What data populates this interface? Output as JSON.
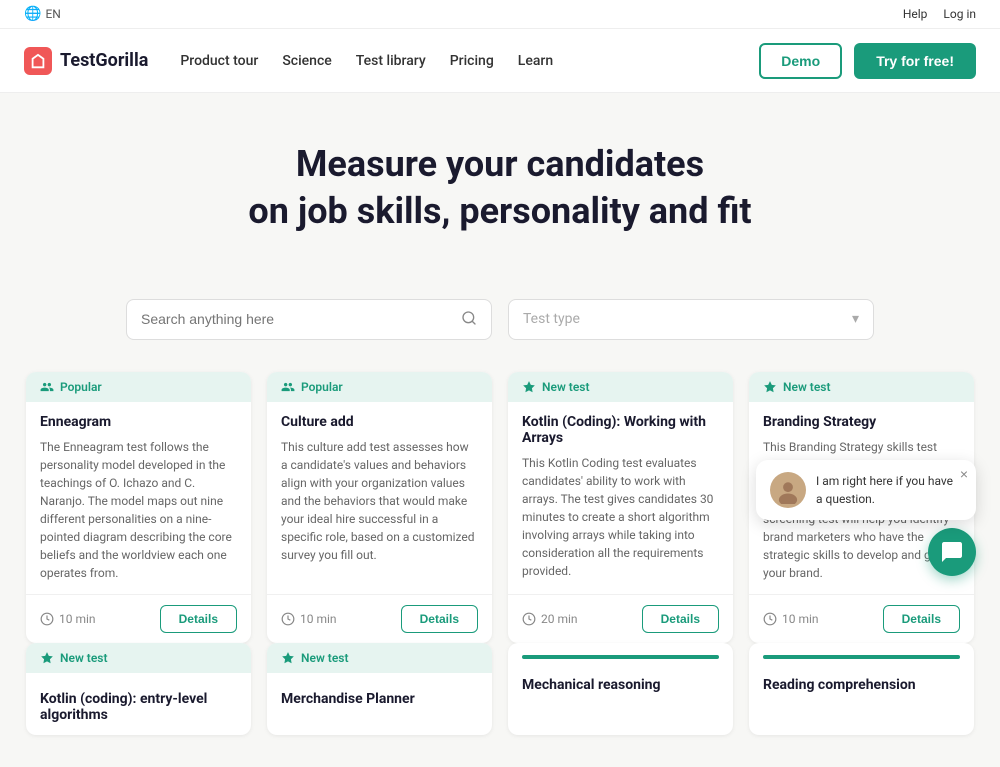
{
  "topbar": {
    "lang": "EN",
    "help": "Help",
    "login": "Log in"
  },
  "navbar": {
    "logo_text": "TestGorilla",
    "nav_items": [
      {
        "label": "Product tour"
      },
      {
        "label": "Science"
      },
      {
        "label": "Test library"
      },
      {
        "label": "Pricing"
      },
      {
        "label": "Learn"
      }
    ],
    "demo_label": "Demo",
    "try_label": "Try for free!"
  },
  "hero": {
    "line1": "Measure your candidates",
    "line2": "on job skills, personality and fit"
  },
  "search": {
    "placeholder": "Search anything here",
    "type_placeholder": "Test type"
  },
  "cards": [
    {
      "badge": "Popular",
      "badge_type": "popular",
      "title": "Enneagram",
      "desc": "The Enneagram test follows the personality model developed in the teachings of O. Ichazo and C. Naranjo. The model maps out nine different personalities on a nine-pointed diagram describing the core beliefs and the worldview each one operates from.",
      "time": "10 min",
      "details_label": "Details"
    },
    {
      "badge": "Popular",
      "badge_type": "popular",
      "title": "Culture add",
      "desc": "This culture add test assesses how a candidate's values and behaviors align with your organization values and the behaviors that would make your ideal hire successful in a specific role, based on a customized survey you fill out.",
      "time": "10 min",
      "details_label": "Details"
    },
    {
      "badge": "New test",
      "badge_type": "new",
      "title": "Kotlin (Coding): Working with Arrays",
      "desc": "This Kotlin Coding test evaluates candidates' ability to work with arrays. The test gives candidates 30 minutes to create a short algorithm involving arrays while taking into consideration all the requirements provided.",
      "time": "20 min",
      "details_label": "Details"
    },
    {
      "badge": "New test",
      "badge_type": "new",
      "title": "Branding Strategy",
      "desc": "This Branding Strategy skills test evaluates candidates' ability to define, position, manage, and develop a brand. This online screening test will help you identify brand marketers who have the strategic skills to develop and grow your brand.",
      "time": "10 min",
      "details_label": "Details"
    }
  ],
  "bottom_cards": [
    {
      "badge": "New test",
      "title": "Kotlin (coding): entry-level algorithms"
    },
    {
      "badge": "New test",
      "title": "Merchandise Planner"
    },
    {
      "badge": "",
      "title": "Mechanical reasoning"
    },
    {
      "badge": "",
      "title": "Reading comprehension"
    }
  ],
  "chat": {
    "message": "I am right here if you have a question.",
    "close_label": "×"
  }
}
